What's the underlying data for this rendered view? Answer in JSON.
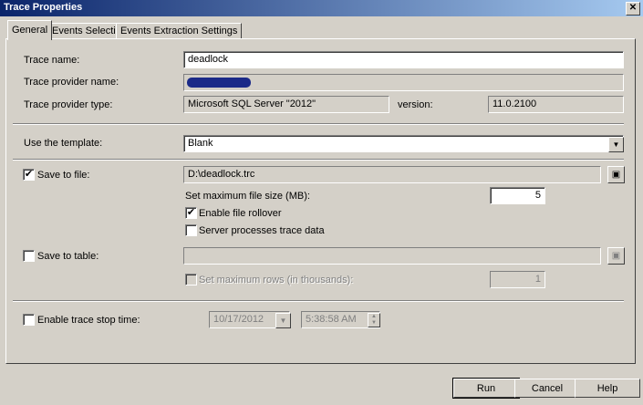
{
  "window": {
    "title": "Trace Properties",
    "close_glyph": "✕"
  },
  "tabs": [
    {
      "label": "General"
    },
    {
      "label": "Events Selection"
    },
    {
      "label": "Events Extraction Settings"
    }
  ],
  "general": {
    "trace_name_label": "Trace name:",
    "trace_name_value": "deadlock",
    "provider_name_label": "Trace provider name:",
    "provider_type_label": "Trace provider type:",
    "provider_type_value": "Microsoft SQL Server \"2012\"",
    "version_label": "version:",
    "version_value": "11.0.2100",
    "template_label": "Use the template:",
    "template_value": "Blank",
    "save_to_file_label": "Save to file:",
    "save_to_file_checked": "✔",
    "file_path": "D:\\deadlock.trc",
    "max_file_size_label": "Set maximum file size (MB):",
    "max_file_size_value": "5",
    "file_rollover_label": "Enable file rollover",
    "file_rollover_checked": "✔",
    "server_processes_label": "Server processes trace data",
    "save_to_table_label": "Save to table:",
    "max_rows_label": "Set maximum rows (in thousands):",
    "max_rows_value": "1",
    "stop_time_label": "Enable trace stop time:",
    "stop_date_value": "10/17/2012",
    "stop_time_value": "5:38:58 AM"
  },
  "buttons": {
    "run": "Run",
    "cancel": "Cancel",
    "help": "Help"
  }
}
